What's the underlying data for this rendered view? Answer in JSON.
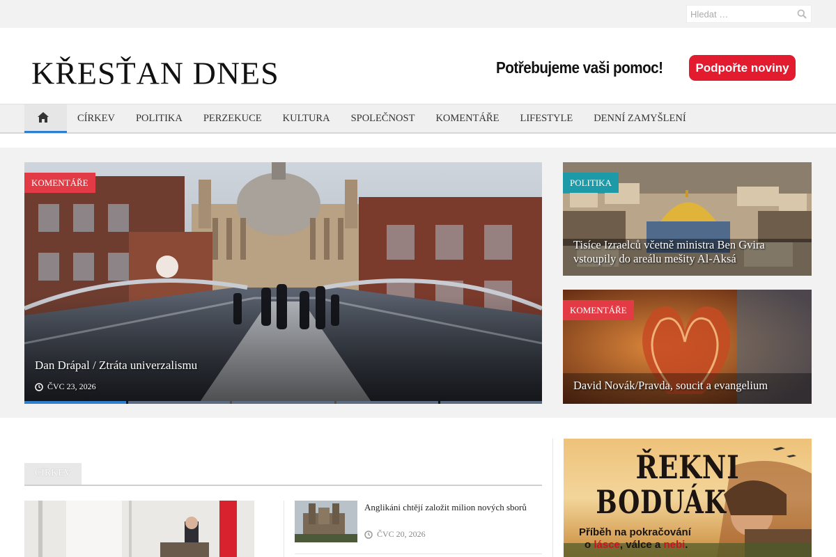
{
  "search": {
    "placeholder": "Hledat …"
  },
  "header": {
    "logo": "KŘESŤAN DNES",
    "banner_text": "Potřebujeme vaši pomoc!",
    "banner_button": "Podpořte noviny"
  },
  "nav": {
    "items": [
      {
        "label": "CÍRKEV"
      },
      {
        "label": "POLITIKA"
      },
      {
        "label": "PERZEKUCE"
      },
      {
        "label": "KULTURA"
      },
      {
        "label": "SPOLEČNOST"
      },
      {
        "label": "KOMENTÁŘE"
      },
      {
        "label": "LIFESTYLE"
      },
      {
        "label": "DENNÍ ZAMYŠLENÍ"
      }
    ]
  },
  "featured": {
    "hero": {
      "category": "KOMENTÁŘE",
      "title": "Dan Drápal / Ztráta univerzalismu",
      "date": "ČVC 23, 2026"
    },
    "side": [
      {
        "category": "POLITIKA",
        "title": "Tisíce Izraelců včetně ministra Ben Gvira vstoupily do areálu mešity Al-Aksá"
      },
      {
        "category": "KOMENTÁŘE",
        "title": "David Novák/Pravda, soucit a evangelium"
      }
    ]
  },
  "section": {
    "tab": "CÍRKEV",
    "list": [
      {
        "title": "Anglikáni chtějí založit milion nových sborů",
        "date": "ČVC 20, 2026"
      }
    ]
  },
  "ad": {
    "line1": "ŘEKNI",
    "line2": "BODUÁK",
    "sub1": "Příběh na pokračování",
    "sub2_a": "o ",
    "sub2_b": "lásce",
    "sub2_c": ", válce a ",
    "sub2_d": "nebi",
    "sub2_e": "."
  },
  "colors": {
    "accent_blue": "#2f7fd1",
    "badge_red": "#e23b45",
    "badge_teal": "#1d9aa8",
    "button_red": "#e21b2f"
  }
}
